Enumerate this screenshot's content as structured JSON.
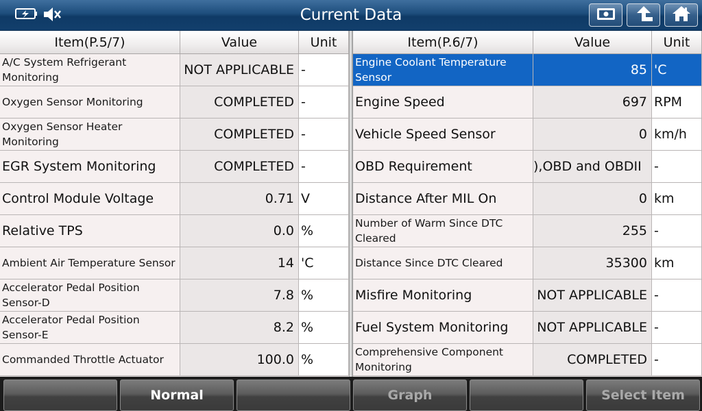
{
  "header": {
    "title": "Current Data",
    "status_icons": [
      "battery-icon",
      "speaker-muted-icon"
    ],
    "nav_buttons": [
      "print-screen-icon",
      "back-arrow-icon",
      "home-icon"
    ]
  },
  "left_table": {
    "headers": {
      "item": "Item(P.5/7)",
      "value": "Value",
      "unit": "Unit"
    },
    "rows": [
      {
        "item": "A/C System Refrigerant Monitoring",
        "value": "NOT APPLICABLE",
        "unit": "-"
      },
      {
        "item": "Oxygen Sensor Monitoring",
        "value": "COMPLETED",
        "unit": "-"
      },
      {
        "item": "Oxygen Sensor Heater Monitoring",
        "value": "COMPLETED",
        "unit": "-"
      },
      {
        "item": "EGR System Monitoring",
        "value": "COMPLETED",
        "unit": "-"
      },
      {
        "item": "Control Module Voltage",
        "value": "0.71",
        "unit": "V"
      },
      {
        "item": "Relative TPS",
        "value": "0.0",
        "unit": "%"
      },
      {
        "item": "Ambient Air Temperature Sensor",
        "value": "14",
        "unit": "'C"
      },
      {
        "item": "Accelerator Pedal Position Sensor-D",
        "value": "7.8",
        "unit": "%"
      },
      {
        "item": "Accelerator Pedal Position Sensor-E",
        "value": "8.2",
        "unit": "%"
      },
      {
        "item": "Commanded Throttle Actuator",
        "value": "100.0",
        "unit": "%"
      }
    ]
  },
  "right_table": {
    "headers": {
      "item": "Item(P.6/7)",
      "value": "Value",
      "unit": "Unit"
    },
    "rows": [
      {
        "item": "Engine Coolant Temperature Sensor",
        "value": "85",
        "unit": "'C"
      },
      {
        "item": "Engine Speed",
        "value": "697",
        "unit": "RPM"
      },
      {
        "item": "Vehicle Speed Sensor",
        "value": "0",
        "unit": "km/h"
      },
      {
        "item": "OBD Requirement",
        "value": "),OBD and OBDII",
        "unit": "-"
      },
      {
        "item": "Distance After MIL On",
        "value": "0",
        "unit": "km"
      },
      {
        "item": "Number of Warm Since DTC Cleared",
        "value": "255",
        "unit": "-"
      },
      {
        "item": "Distance Since DTC Cleared",
        "value": "35300",
        "unit": "km"
      },
      {
        "item": "Misfire Monitoring",
        "value": "NOT APPLICABLE",
        "unit": "-"
      },
      {
        "item": "Fuel System Monitoring",
        "value": "NOT APPLICABLE",
        "unit": "-"
      },
      {
        "item": "Comprehensive Component Monitoring",
        "value": "COMPLETED",
        "unit": "-"
      }
    ],
    "selected_row": 0
  },
  "toolbar": {
    "buttons": [
      "",
      "Normal",
      "",
      "Graph",
      "",
      "Select Item"
    ]
  },
  "colors": {
    "selection": "#1265c4",
    "title_bar": "#1d4d7c",
    "toolbar": "#1c1c1c"
  }
}
